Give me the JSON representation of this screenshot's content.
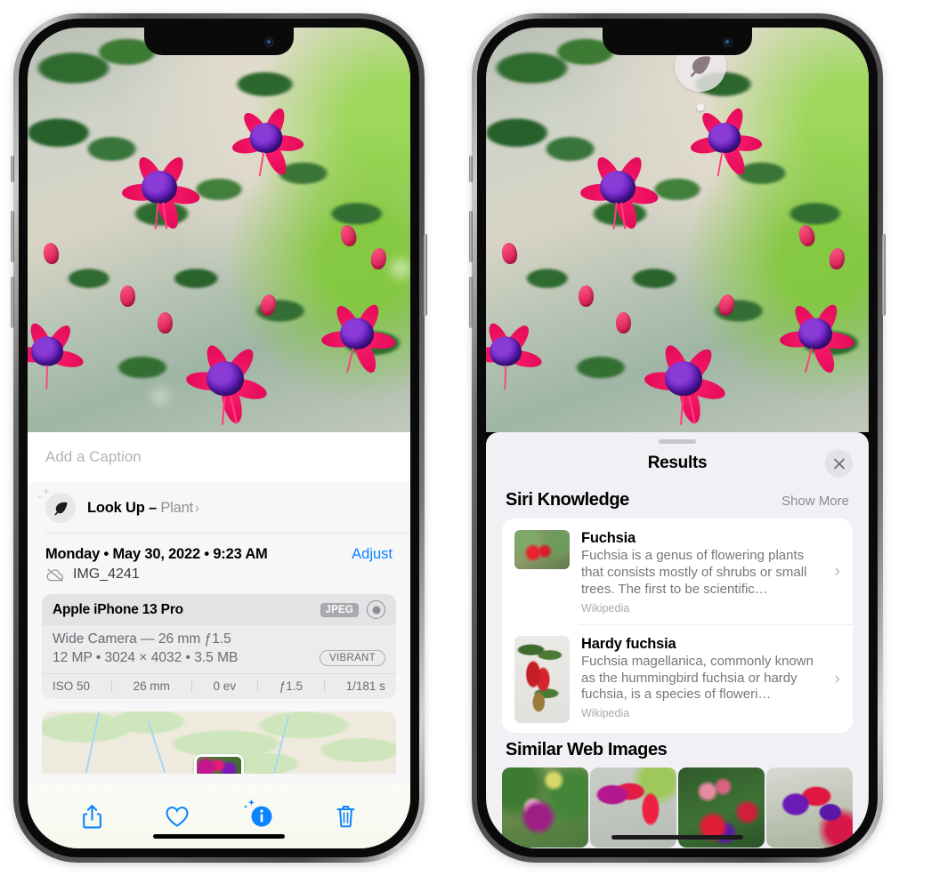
{
  "left_phone": {
    "photo": {
      "alt": "fuchsia-flowers-photo"
    },
    "caption_placeholder": "Add a Caption",
    "lookup": {
      "label": "Look Up – ",
      "subject": "Plant",
      "chevron": "›",
      "icon": "leaf-icon"
    },
    "metadata": {
      "date": "Monday • May 30, 2022 • 9:23 AM",
      "adjust_label": "Adjust",
      "filename": "IMG_4241",
      "cloud_icon": "icloud-slash-icon"
    },
    "camera_card": {
      "model": "Apple iPhone 13 Pro",
      "format_tag": "JPEG",
      "raw_icon": "aperture-icon",
      "lens_line": "Wide Camera — 26 mm ƒ1.5",
      "size_line": "12 MP • 3024 × 4032 • 3.5 MB",
      "profile_tag": "VIBRANT",
      "exif": [
        "ISO 50",
        "26 mm",
        "0 ev",
        "ƒ1.5",
        "1/181 s"
      ]
    },
    "map": {
      "label": "photo-location-map"
    },
    "toolbar": [
      {
        "name": "share-button",
        "icon": "share-icon"
      },
      {
        "name": "favorite-button",
        "icon": "heart-icon"
      },
      {
        "name": "info-button",
        "icon": "info-sparkle-icon",
        "glyph": "i"
      },
      {
        "name": "delete-button",
        "icon": "trash-icon"
      }
    ]
  },
  "right_phone": {
    "photo": {
      "alt": "fuchsia-flowers-photo"
    },
    "lookup_pin": {
      "icon": "leaf-icon"
    },
    "sheet": {
      "title": "Results",
      "close_label": "✕",
      "sections": [
        {
          "title": "Siri Knowledge",
          "action": "Show More",
          "items": [
            {
              "title": "Fuchsia",
              "snippet": "Fuchsia is a genus of flowering plants that consists mostly of shrubs or small trees. The first to be scientific…",
              "source": "Wikipedia",
              "chevron": "›"
            },
            {
              "title": "Hardy fuchsia",
              "snippet": "Fuchsia magellanica, commonly known as the hummingbird fuchsia or hardy fuchsia, is a species of floweri…",
              "source": "Wikipedia",
              "chevron": "›"
            }
          ]
        },
        {
          "title": "Similar Web Images",
          "images": [
            "similar-web-image-1",
            "similar-web-image-2",
            "similar-web-image-3",
            "similar-web-image-4"
          ]
        }
      ]
    }
  },
  "colors": {
    "accent_blue": "#0a84ff",
    "sheet_bg": "#f1f1f5",
    "info_bg": "#f7f7f7",
    "card_bg": "#ececee",
    "secondary_text": "#8e8e93"
  }
}
